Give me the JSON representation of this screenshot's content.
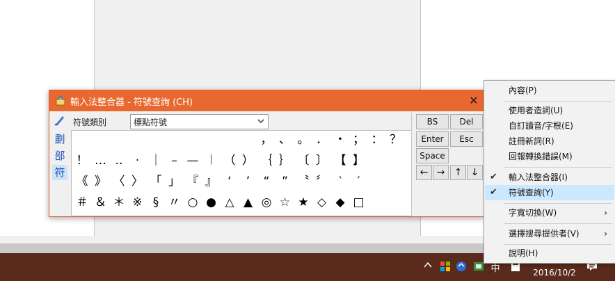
{
  "ime_window": {
    "title": "輸入法整合器 - 符號查詢 (CH)",
    "close_glyph": "✕",
    "side_items": [
      "劃",
      "部",
      "符"
    ],
    "category_label": "符號類別",
    "category_value": "標點符號",
    "symbols": [
      [
        "",
        "",
        "",
        "",
        "",
        "",
        "",
        "",
        "",
        "",
        "，",
        "、",
        "。",
        "．",
        "・",
        "；",
        "：",
        "？"
      ],
      [
        "！",
        "…",
        "‥",
        "·",
        "｜",
        "–",
        "—",
        "︱",
        "（",
        "）",
        "｛",
        "｝",
        "〔",
        "〕",
        "【",
        "】",
        "",
        ""
      ],
      [
        "《",
        "》",
        "〈",
        "〉",
        "「",
        "」",
        "『",
        "』",
        "‘",
        "’",
        "“",
        "”",
        "〝",
        "〞",
        "‵",
        "′",
        "",
        ""
      ],
      [
        "＃",
        "＆",
        "＊",
        "※",
        "§",
        "〃",
        "○",
        "●",
        "△",
        "▲",
        "◎",
        "☆",
        "★",
        "◇",
        "◆",
        "□",
        "",
        ""
      ]
    ],
    "keys": {
      "bs": "BS",
      "del": "Del",
      "enter": "Enter",
      "esc": "Esc",
      "space": "Space",
      "left": "←",
      "right": "→",
      "up": "↑",
      "down": "↓"
    }
  },
  "context_menu": {
    "items": [
      {
        "label": "內容(P)",
        "checked": false
      },
      {
        "label": "使用者造詞(U)",
        "checked": false
      },
      {
        "label": "自訂讀音/字根(E)",
        "checked": false
      },
      {
        "label": "註冊新詞(R)",
        "checked": false
      },
      {
        "label": "回報轉換錯誤(M)",
        "checked": false
      },
      {
        "label": "輸入法整合器(I)",
        "checked": true
      },
      {
        "label": "符號查詢(Y)",
        "checked": true
      },
      {
        "label": "字寬切換(W)",
        "checked": false
      },
      {
        "label": "選擇搜尋提供者(V)",
        "checked": false
      },
      {
        "label": "說明(H)",
        "checked": false
      }
    ]
  },
  "taskbar": {
    "ime_indicator": "中",
    "date": "2016/10/2"
  },
  "colors": {
    "title_bar": "#e8682f",
    "taskbar": "#5a2a1c",
    "menu_highlight": "#cce8ff"
  }
}
